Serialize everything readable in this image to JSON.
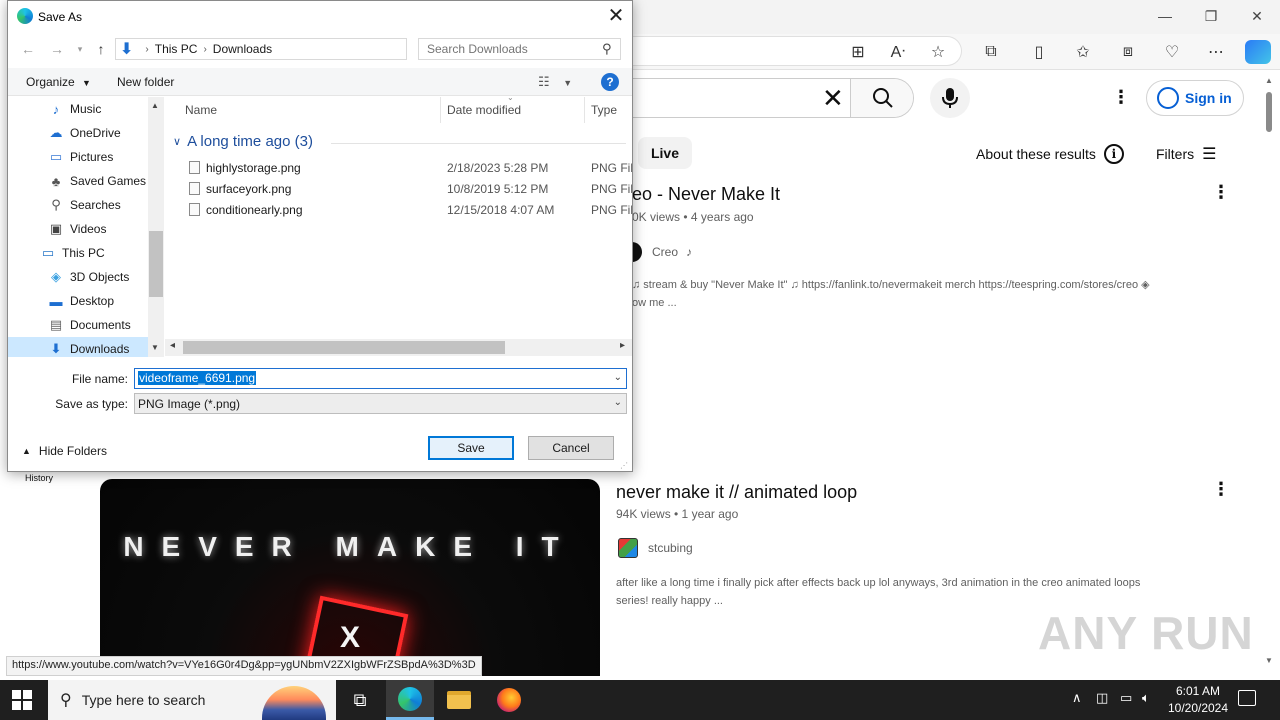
{
  "dialog": {
    "title": "Save As",
    "breadcrumb": [
      "This PC",
      "Downloads"
    ],
    "search_placeholder": "Search Downloads",
    "organize_label": "Organize",
    "new_folder_label": "New folder",
    "nav_items": [
      {
        "label": "Music",
        "icon": "music-icon"
      },
      {
        "label": "OneDrive",
        "icon": "onedrive-icon"
      },
      {
        "label": "Pictures",
        "icon": "pictures-icon"
      },
      {
        "label": "Saved Games",
        "icon": "saved-games-icon"
      },
      {
        "label": "Searches",
        "icon": "searches-icon"
      },
      {
        "label": "Videos",
        "icon": "videos-icon"
      },
      {
        "label": "This PC",
        "icon": "computer-icon"
      },
      {
        "label": "3D Objects",
        "icon": "3d-objects-icon"
      },
      {
        "label": "Desktop",
        "icon": "desktop-icon"
      },
      {
        "label": "Documents",
        "icon": "documents-icon"
      },
      {
        "label": "Downloads",
        "icon": "downloads-icon"
      }
    ],
    "columns": {
      "name": "Name",
      "date": "Date modified",
      "type": "Type"
    },
    "group_label": "A long time ago (3)",
    "files": [
      {
        "name": "highlystorage.png",
        "date": "2/18/2023 5:28 PM",
        "type": "PNG File"
      },
      {
        "name": "surfaceyork.png",
        "date": "10/8/2019 5:12 PM",
        "type": "PNG File"
      },
      {
        "name": "conditionearly.png",
        "date": "12/15/2018 4:07 AM",
        "type": "PNG File"
      }
    ],
    "file_name_label": "File name:",
    "file_name_value": "videoframe_6691.png",
    "save_type_label": "Save as type:",
    "save_type_value": "PNG Image (*.png)",
    "hide_folders_label": "Hide Folders",
    "save_label": "Save",
    "cancel_label": "Cancel"
  },
  "youtube": {
    "sign_in_label": "Sign in",
    "live_chip": "Live",
    "about_results": "About these results",
    "filters_label": "Filters",
    "history_label": "History",
    "results": [
      {
        "title": "eo - Never Make It",
        "meta": "0K views • 4 years ago",
        "channel": "Creo",
        "desc_line1": "♫ stream & buy \"Never Make It\" ♫ https://fanlink.to/nevermakeit merch https://teespring.com/stores/creo ◈",
        "desc_line2": "ow me ..."
      },
      {
        "title": "never make it // animated loop",
        "meta": "94K views • 1 year ago",
        "channel": "stcubing",
        "desc_line1": "after like a long time i finally pick after effects back up lol anyways, 3rd animation in the creo animated loops",
        "desc_line2": "series! really happy ..."
      }
    ],
    "thumbnail_text": "NEVER MAKE IT",
    "thumbnail_x": "X"
  },
  "status_url": "https://www.youtube.com/watch?v=VYe16G0r4Dg&pp=ygUNbmV2ZXIgbWFrZSBpdA%3D%3D",
  "watermark": "ANY RUN",
  "taskbar": {
    "search_placeholder": "Type here to search",
    "time": "6:01 AM",
    "date": "10/20/2024"
  },
  "colors": {
    "accent": "#0078d7",
    "youtube_link": "#065fd4",
    "taskbar": "#1f1f1f"
  }
}
